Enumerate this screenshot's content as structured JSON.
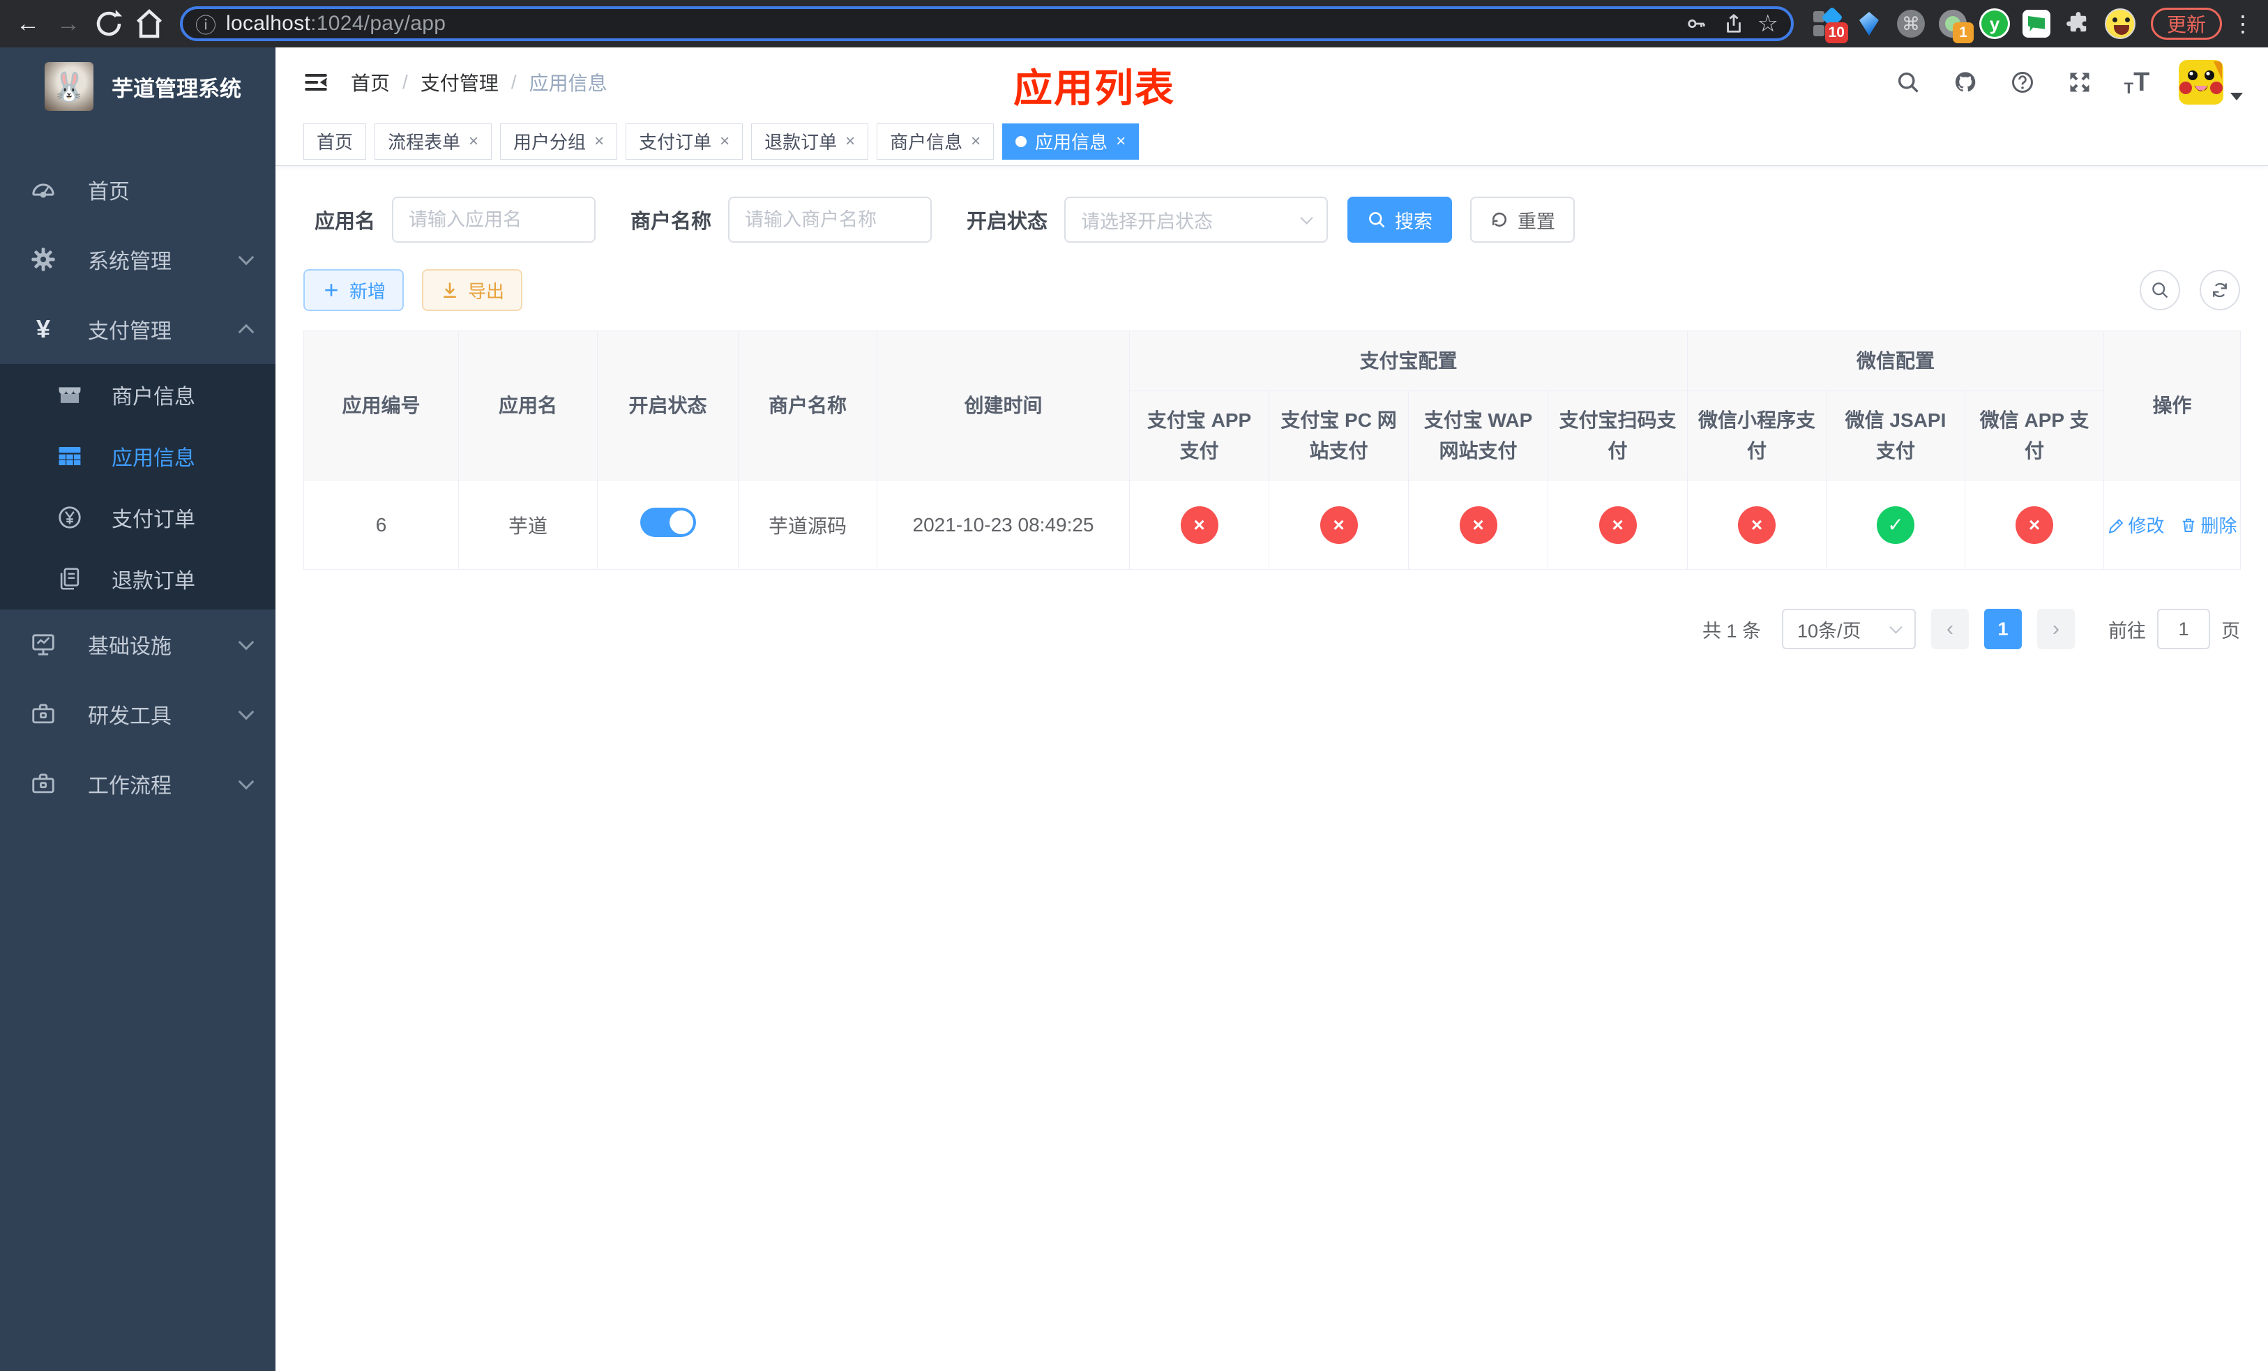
{
  "browser": {
    "url": {
      "host": "localhost",
      "path": ":1024/pay/app"
    },
    "update_button": "更新",
    "extensions": {
      "badge_1": "10",
      "badge_2": "1",
      "y_letter": "y"
    }
  },
  "sidebar": {
    "title": "芋道管理系统",
    "items": [
      {
        "label": "首页"
      },
      {
        "label": "系统管理"
      },
      {
        "label": "支付管理"
      },
      {
        "label": "商户信息"
      },
      {
        "label": "应用信息"
      },
      {
        "label": "支付订单"
      },
      {
        "label": "退款订单"
      },
      {
        "label": "基础设施"
      },
      {
        "label": "研发工具"
      },
      {
        "label": "工作流程"
      }
    ]
  },
  "navbar": {
    "breadcrumb": [
      {
        "label": "首页"
      },
      {
        "label": "支付管理"
      },
      {
        "label": "应用信息"
      }
    ],
    "page_title": "应用列表"
  },
  "tabs": [
    {
      "label": "首页"
    },
    {
      "label": "流程表单"
    },
    {
      "label": "用户分组"
    },
    {
      "label": "支付订单"
    },
    {
      "label": "退款订单"
    },
    {
      "label": "商户信息"
    },
    {
      "label": "应用信息"
    }
  ],
  "filters": {
    "app_name": {
      "label": "应用名",
      "placeholder": "请输入应用名"
    },
    "merchant_name": {
      "label": "商户名称",
      "placeholder": "请输入商户名称"
    },
    "status": {
      "label": "开启状态",
      "placeholder": "请选择开启状态"
    },
    "search": "搜索",
    "reset": "重置"
  },
  "toolbar": {
    "add": "新增",
    "export": "导出"
  },
  "table": {
    "headers": {
      "app_id": "应用编号",
      "app_name": "应用名",
      "status": "开启状态",
      "merchant": "商户名称",
      "created": "创建时间",
      "alipay_group": "支付宝配置",
      "wechat_group": "微信配置",
      "actions": "操作",
      "channels": [
        "支付宝 APP 支付",
        "支付宝 PC 网站支付",
        "支付宝 WAP 网站支付",
        "支付宝扫码支付",
        "微信小程序支付",
        "微信 JSAPI 支付",
        "微信 APP 支付"
      ]
    },
    "rows": [
      {
        "app_id": "6",
        "app_name": "芋道",
        "enabled": true,
        "merchant": "芋道源码",
        "created": "2021-10-23 08:49:25",
        "channels": [
          false,
          false,
          false,
          false,
          false,
          true,
          false
        ],
        "edit": "修改",
        "delete": "删除"
      }
    ]
  },
  "pagination": {
    "total": "共 1 条",
    "page_size": "10条/页",
    "page": "1",
    "goto_label": "前往",
    "goto_value": "1",
    "unit": "页"
  },
  "icons": {
    "check": "✓",
    "cross": "×"
  },
  "colors": {
    "accent": "#409eff",
    "danger": "#f8504f",
    "success": "#13ce66",
    "warning": "#e6a23c",
    "title_red": "#fe2b00",
    "sidebar_bg": "#304156",
    "submenu_bg": "#1f2d3d"
  }
}
